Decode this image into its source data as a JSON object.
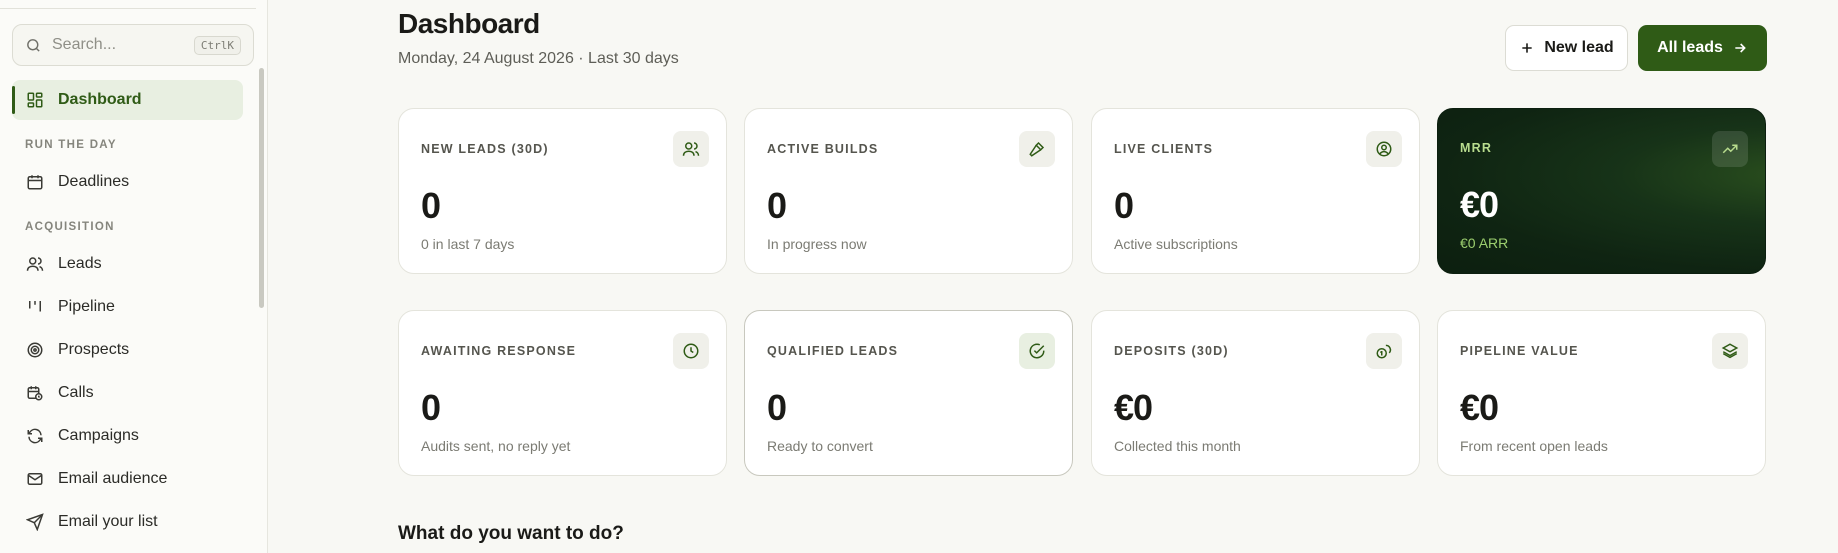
{
  "sidebar": {
    "search_placeholder": "Search...",
    "search_shortcut": "CtrlK",
    "dashboard": "Dashboard",
    "section_run": "RUN THE DAY",
    "deadlines": "Deadlines",
    "section_acq": "ACQUISITION",
    "items": [
      "Leads",
      "Pipeline",
      "Prospects",
      "Calls",
      "Campaigns",
      "Email audience",
      "Email your list"
    ]
  },
  "header": {
    "title": "Dashboard",
    "subtitle": "Monday, 24 August 2026 · Last 30 days",
    "new_lead": "New lead",
    "all_leads": "All leads"
  },
  "cards": [
    {
      "label": "NEW LEADS (30D)",
      "value": "0",
      "sub": "0 in last 7 days",
      "icon": "users-icon"
    },
    {
      "label": "ACTIVE BUILDS",
      "value": "0",
      "sub": "In progress now",
      "icon": "hammer-icon"
    },
    {
      "label": "LIVE CLIENTS",
      "value": "0",
      "sub": "Active subscriptions",
      "icon": "user-circle-icon"
    },
    {
      "label": "MRR",
      "value": "€0",
      "sub": "€0 ARR",
      "icon": "trending-up-icon"
    },
    {
      "label": "AWAITING RESPONSE",
      "value": "0",
      "sub": "Audits sent, no reply yet",
      "icon": "clock-icon"
    },
    {
      "label": "QUALIFIED LEADS",
      "value": "0",
      "sub": "Ready to convert",
      "icon": "check-circle-icon"
    },
    {
      "label": "DEPOSITS (30D)",
      "value": "€0",
      "sub": "Collected this month",
      "icon": "coins-icon"
    },
    {
      "label": "PIPELINE VALUE",
      "value": "€0",
      "sub": "From recent open leads",
      "icon": "layers-icon"
    }
  ],
  "section_title": "What do you want to do?",
  "colors": {
    "accent": "#2f5b16",
    "accent_bg": "#e8efe1",
    "dark_card": "#0f2412"
  }
}
